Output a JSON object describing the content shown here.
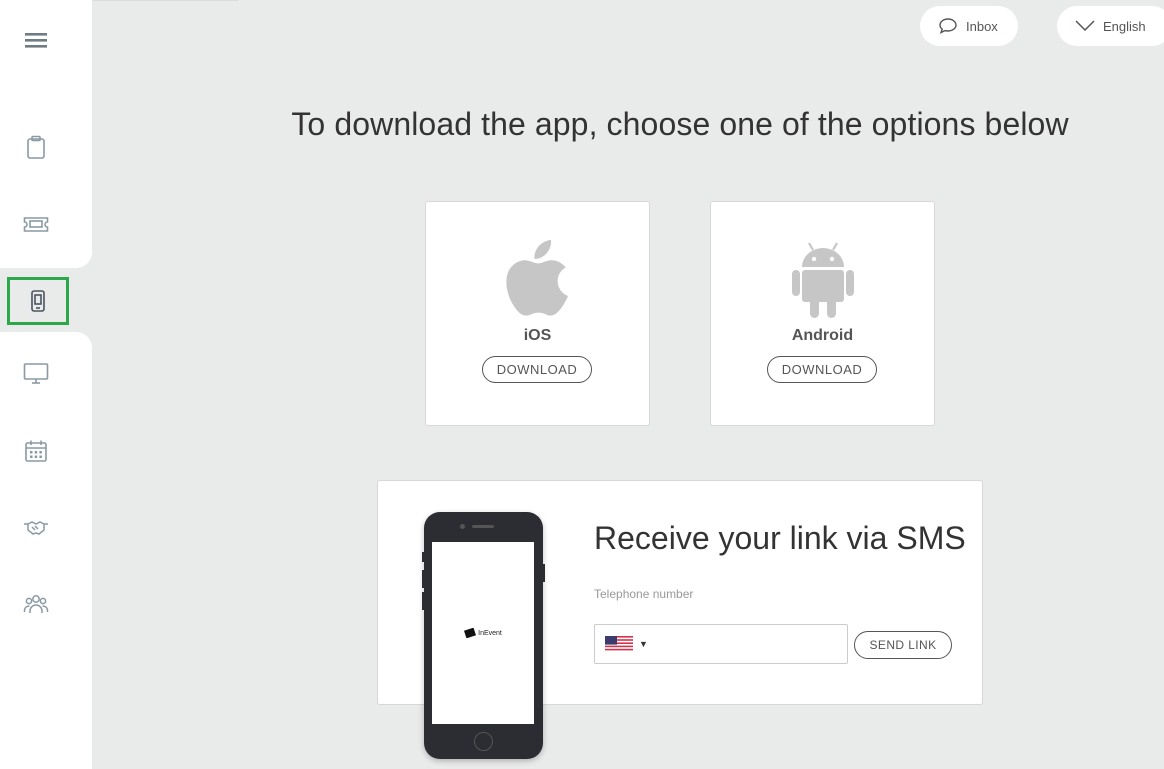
{
  "header": {
    "inbox_label": "Inbox",
    "language_label": "English"
  },
  "main": {
    "headline": "To download the app, choose one of the options below",
    "cards": [
      {
        "platform": "iOS",
        "button_label": "DOWNLOAD",
        "icon": "apple-icon"
      },
      {
        "platform": "Android",
        "button_label": "DOWNLOAD",
        "icon": "android-icon"
      }
    ],
    "sms": {
      "title": "Receive your link via SMS",
      "telephone_label": "Telephone number",
      "telephone_value": "",
      "country_flag": "us-flag-icon",
      "send_label": "SEND LINK"
    },
    "phone_brand": "InEvent"
  },
  "sidebar": {
    "items": [
      {
        "icon": "menu-icon"
      },
      {
        "icon": "clipboard-icon"
      },
      {
        "icon": "ticket-icon"
      },
      {
        "icon": "mobile-phone-icon",
        "active": true
      },
      {
        "icon": "monitor-icon"
      },
      {
        "icon": "calendar-icon"
      },
      {
        "icon": "handshake-icon"
      },
      {
        "icon": "people-icon"
      }
    ]
  },
  "colors": {
    "active_outline": "#2aa84a",
    "background": "#e9eaea",
    "icon_gray": "#8a9aa3"
  }
}
